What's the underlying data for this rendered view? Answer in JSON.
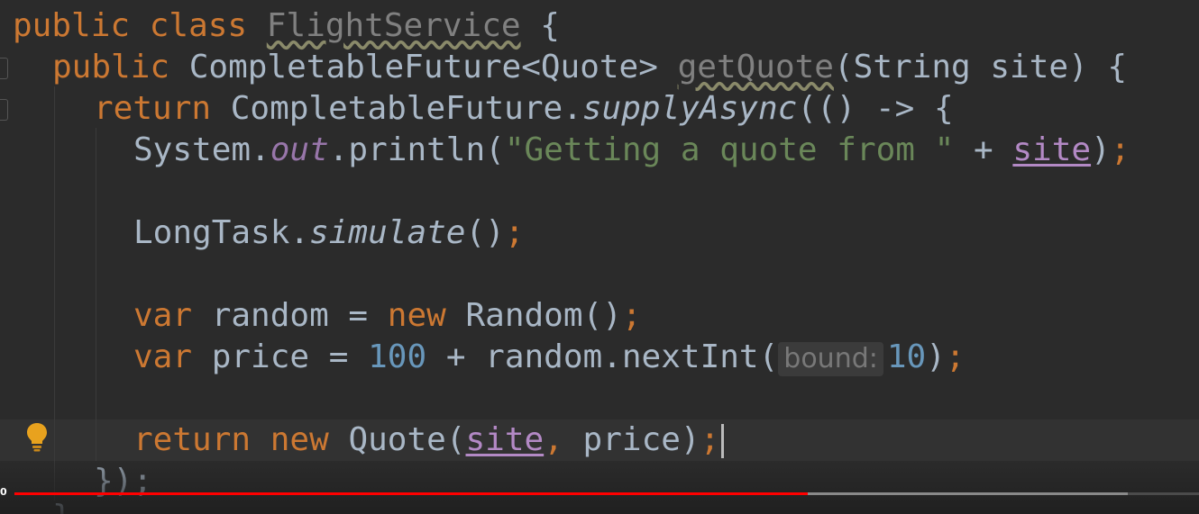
{
  "editor": {
    "line1": {
      "kw_public": "public",
      "kw_class": "class",
      "class_name": "FlightService",
      "brace": "{"
    },
    "line2": {
      "kw_public": "public",
      "type": "CompletableFuture<Quote>",
      "method": "getQuote",
      "params": "(String site) {"
    },
    "line3": {
      "kw_return": "return",
      "target": "CompletableFuture.",
      "method": "supplyAsync",
      "rest": "(() -> {"
    },
    "line4": {
      "obj": "System.",
      "field": "out",
      "call": ".println(",
      "string": "\"Getting a quote from \"",
      "plus": " + ",
      "param": "site",
      "end_paren": ")",
      "semicolon": ";"
    },
    "line5": {
      "obj": "LongTask.",
      "method": "simulate",
      "call": "()",
      "semicolon": ";"
    },
    "line6": {
      "kw_var": "var",
      "decl": " random = ",
      "kw_new": "new",
      "ctor": " Random()",
      "semicolon": ";"
    },
    "line7": {
      "kw_var": "var",
      "decl": " price = ",
      "num1": "100",
      "expr": " + random.nextInt(",
      "hint": "bound:",
      "num2": "10",
      "end_paren": ")",
      "semicolon": ";"
    },
    "line8": {
      "kw_return": "return",
      "kw_new": "new",
      "ctor": " Quote(",
      "param": "site",
      "comma": ",",
      "rest": " price)",
      "semicolon": ";"
    },
    "line9": {
      "text": "});"
    },
    "line10": {
      "text": "}"
    }
  },
  "video": {
    "time": "0",
    "progress": 0.67,
    "buffered": 0.94,
    "progress_color": "#ff0000"
  },
  "colors": {
    "background": "#2b2b2b",
    "keyword": "#cc7832",
    "string": "#6a8759",
    "number": "#6897bb",
    "field": "#9876aa",
    "text": "#a9b7c6"
  },
  "icons": {
    "intention": "lightbulb-icon",
    "fold": "fold-marker-icon"
  }
}
